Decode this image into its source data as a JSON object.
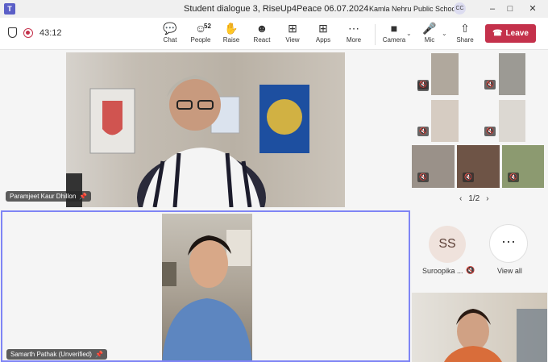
{
  "window": {
    "title": "Student dialogue 3, RiseUp4Peace 06.07.2024",
    "org": "Kamla Nehru Public School",
    "org_badge": "CC",
    "app_icon": "T"
  },
  "toolbar": {
    "timer": "43:12",
    "chat": "Chat",
    "people": "People",
    "people_count": "52",
    "raise": "Raise",
    "react": "React",
    "view": "View",
    "apps": "Apps",
    "more": "More",
    "camera": "Camera",
    "mic": "Mic",
    "share": "Share",
    "leave": "Leave"
  },
  "stage": {
    "main_name": "Paramjeet Kaur Dhillon",
    "second_name": "Samarth Pathak (Unverified)"
  },
  "gallery": {
    "pager": "1/2",
    "ss_initials": "SS",
    "ss_name": "Suroopika ...",
    "view_all": "View all"
  },
  "colors": {
    "leave_red": "#c4314b",
    "active_border": "#7f85f5",
    "accent": "#5b5fc7"
  }
}
